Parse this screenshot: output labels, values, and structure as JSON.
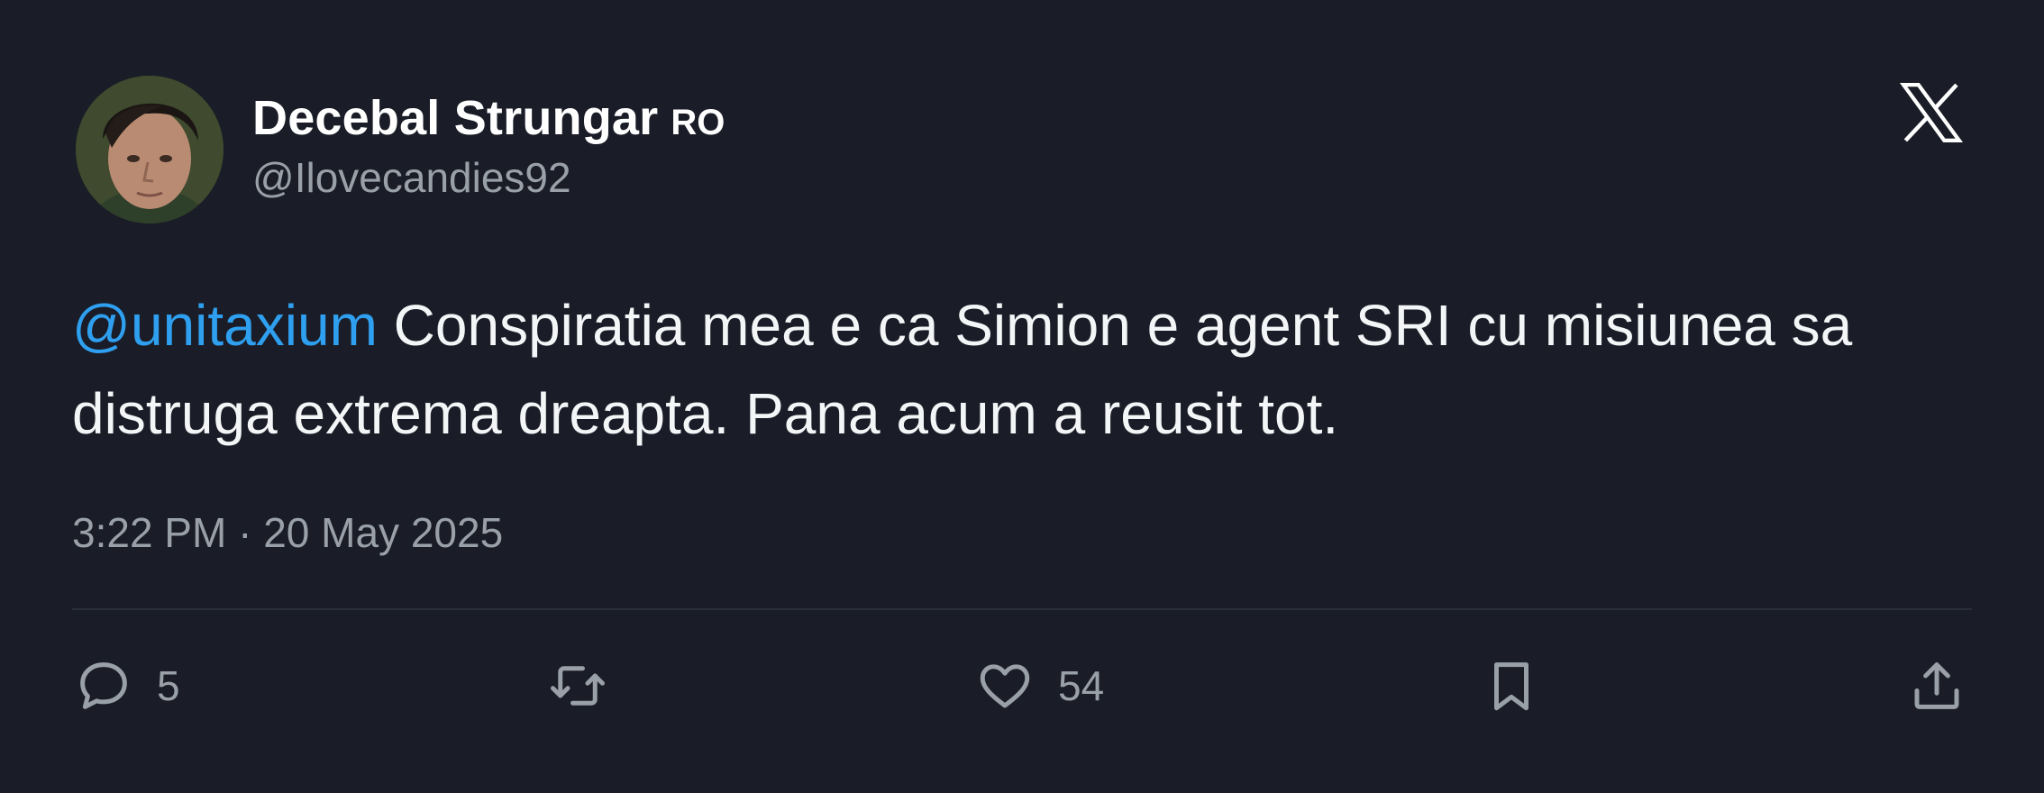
{
  "author": {
    "display_name": "Decebal Strungar",
    "name_suffix": "RO",
    "handle": "@Ilovecandies92"
  },
  "tweet": {
    "mention": "@unitaxium",
    "text": " Conspiratia mea e ca Simion e agent SRI cu misiunea sa distruga extrema dreapta. Pana acum a reusit tot.",
    "timestamp": "3:22 PM · 20 May 2025"
  },
  "actions": {
    "reply_count": "5",
    "like_count": "54"
  },
  "icons": {
    "brand": "x-logo-icon",
    "reply": "reply-icon",
    "retweet": "retweet-icon",
    "like": "heart-icon",
    "bookmark": "bookmark-icon",
    "share": "share-icon"
  },
  "colors": {
    "background": "#1a1d27",
    "mention": "#2f9ff0",
    "secondary_text": "#9aa0a8",
    "primary_text": "#ffffff"
  }
}
